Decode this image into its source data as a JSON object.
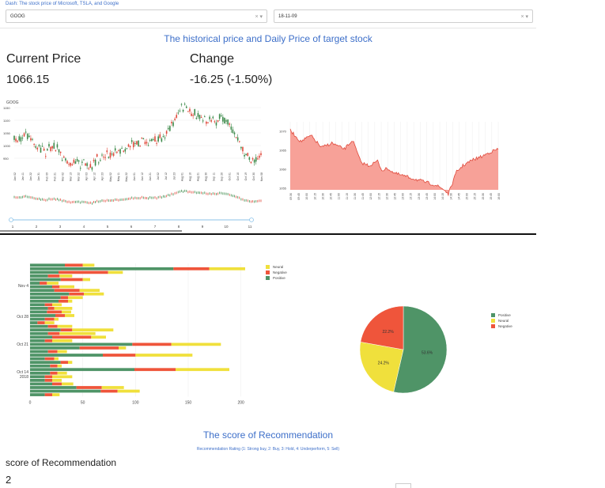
{
  "header": {
    "link_text": "Dash: The stock price of Microsoft, TSLA, and Google"
  },
  "stock_select": {
    "value": "GOOG",
    "clear": "×",
    "caret": "▾"
  },
  "date_select": {
    "value": "18-11-09",
    "clear": "×",
    "caret": "▾"
  },
  "main_title": "The historical price and Daily Price of target stock",
  "current_price": {
    "label": "Current Price",
    "value": "1066.15"
  },
  "change": {
    "label": "Change",
    "value": "-16.25 (-1.50%)"
  },
  "candle_chart": {
    "legend": "GOOG",
    "up_color": "#3c8a4a",
    "down_color": "#e0493b",
    "y_ticks": [
      "1150",
      "1100",
      "1050",
      "1000",
      "950"
    ],
    "x_ticks": [
      "Jan 02",
      "Jan 11",
      "Jan 22",
      "Jan 31",
      "Feb 09",
      "Feb 21",
      "Mar 02",
      "Mar 13",
      "Mar 22",
      "Apr 03",
      "Apr 12",
      "Apr 23",
      "May 02",
      "May 11",
      "May 22",
      "Jun 01",
      "Jun 12",
      "Jun 21",
      "Jul 02",
      "Jul 12",
      "Jul 23",
      "Aug 01",
      "Aug 10",
      "Aug 21",
      "Aug 30",
      "Sep 11",
      "Sep 20",
      "Oct 01",
      "Oct 10",
      "Oct 19",
      "Oct 30",
      "Nov 08"
    ],
    "slider_ticks": [
      "1",
      "2",
      "3",
      "4",
      "5",
      "6",
      "7",
      "8",
      "9",
      "10",
      "11"
    ]
  },
  "intraday_chart": {
    "fill_color": "#f7a198",
    "line_color": "#e0493b",
    "y_ticks": [
      "1070",
      "1065",
      "1060",
      "1055"
    ],
    "x_ticks": [
      "09:30",
      "09:45",
      "10:00",
      "10:15",
      "10:30",
      "10:45",
      "11:00",
      "11:15",
      "11:30",
      "11:45",
      "12:00",
      "12:15",
      "12:30",
      "12:45",
      "13:00",
      "13:15",
      "13:30",
      "13:45",
      "14:00",
      "14:15",
      "14:30",
      "14:45",
      "15:00",
      "15:15",
      "15:30",
      "15:45",
      "16:00"
    ]
  },
  "chart_data": [
    {
      "type": "bar",
      "orientation": "horizontal",
      "stacked": true,
      "y_tick_labels": [
        "Nov 4",
        "Oct 28",
        "Oct 21",
        "Oct 14\n2018"
      ],
      "x_ticks": [
        "0",
        "50",
        "100",
        "150",
        "200"
      ],
      "xlim": [
        0,
        210
      ],
      "legend": "top-right",
      "series": [
        {
          "name": "Positive",
          "color": "#4f9467",
          "values": [
            33,
            136,
            27,
            17,
            29,
            9,
            21,
            23,
            37,
            29,
            27,
            14,
            17,
            16,
            24,
            14,
            7,
            17,
            29,
            17,
            21,
            14,
            97,
            47,
            17,
            69,
            14,
            29,
            19,
            99,
            19,
            14,
            14,
            21,
            44,
            67,
            14
          ]
        },
        {
          "name": "Negative",
          "color": "#ef553b",
          "values": [
            17,
            34,
            47,
            11,
            21,
            7,
            7,
            24,
            14,
            7,
            9,
            7,
            6,
            14,
            9,
            9,
            7,
            9,
            11,
            11,
            37,
            7,
            37,
            37,
            9,
            31,
            9,
            7,
            7,
            39,
            7,
            7,
            7,
            9,
            24,
            16,
            7
          ]
        },
        {
          "name": "Neural",
          "color": "#f0e03c",
          "values": [
            11,
            34,
            14,
            12,
            7,
            11,
            14,
            19,
            19,
            14,
            4,
            9,
            17,
            9,
            9,
            4,
            9,
            14,
            39,
            34,
            14,
            19,
            47,
            7,
            9,
            54,
            4,
            4,
            4,
            51,
            9,
            19,
            9,
            11,
            21,
            21,
            7
          ]
        }
      ]
    },
    {
      "type": "pie",
      "labels": [
        "Positive",
        "Neural",
        "Negative"
      ],
      "values": [
        53.6,
        24.2,
        22.2
      ],
      "slice_labels": [
        "53.6%",
        "24.2%",
        "22.2%"
      ],
      "colors": [
        "#4f9467",
        "#f0e03c",
        "#ef553b"
      ],
      "legend": "top-right"
    }
  ],
  "bar_legend": [
    "Neural",
    "Negative",
    "Positive"
  ],
  "recommendation": {
    "title": "The score of Recommendation",
    "subtitle": "Recommendation Rating (1: Strong buy, 2: Buy, 3: Hold, 4: Underperform, 5: Sell)",
    "label": "score of Recommendation",
    "value": "2"
  }
}
